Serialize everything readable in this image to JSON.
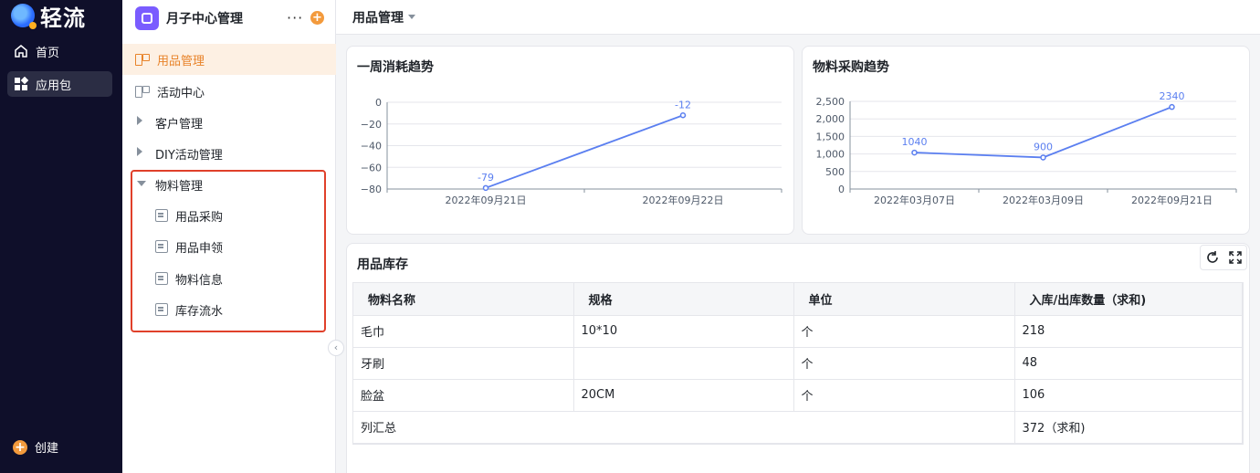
{
  "brand": {
    "name": "轻流"
  },
  "rail": {
    "items": [
      {
        "label": "首页"
      },
      {
        "label": "应用包"
      }
    ],
    "create_label": "创建"
  },
  "app": {
    "title": "月子中心管理",
    "more": "···",
    "add": "+",
    "menu": [
      {
        "label": "用品管理"
      },
      {
        "label": "活动中心"
      },
      {
        "label": "客户管理"
      },
      {
        "label": "DIY活动管理"
      },
      {
        "label": "物料管理"
      }
    ],
    "submenu": [
      {
        "label": "用品采购"
      },
      {
        "label": "用品申领"
      },
      {
        "label": "物料信息"
      },
      {
        "label": "库存流水"
      }
    ]
  },
  "page": {
    "title": "用品管理"
  },
  "charts": [
    {
      "type": "line",
      "title": "一周消耗趋势",
      "x": [
        "2022年09月21日",
        "2022年09月22日"
      ],
      "values": [
        -79,
        -12
      ],
      "point_labels": [
        "-79",
        "-12"
      ],
      "ylim": [
        -80,
        0
      ],
      "yticks": [
        "0",
        "−20",
        "−40",
        "−60",
        "−80"
      ],
      "ytick_values": [
        0,
        -20,
        -40,
        -60,
        -80
      ],
      "grid": true,
      "color": "#5b7ff0"
    },
    {
      "type": "line",
      "title": "物料采购趋势",
      "x": [
        "2022年03月07日",
        "2022年03月09日",
        "2022年09月21日"
      ],
      "values": [
        1040,
        900,
        2340
      ],
      "point_labels": [
        "1040",
        "900",
        "2340"
      ],
      "ylim": [
        0,
        2500
      ],
      "yticks": [
        "2,500",
        "2,000",
        "1,500",
        "1,000",
        "500",
        "0"
      ],
      "ytick_values": [
        2500,
        2000,
        1500,
        1000,
        500,
        0
      ],
      "grid": true,
      "color": "#5b7ff0"
    }
  ],
  "inventory": {
    "title": "用品库存",
    "columns": [
      "物料名称",
      "规格",
      "单位",
      "入库/出库数量（求和)"
    ],
    "rows": [
      [
        "毛巾",
        "10*10",
        "个",
        "218"
      ],
      [
        "牙刷",
        "",
        "个",
        "48"
      ],
      [
        "脸盆",
        "20CM",
        "个",
        "106"
      ]
    ],
    "total_label": "列汇总",
    "total_value": "372（求和)"
  },
  "colors": {
    "accent": "#e8832a",
    "highlight": "#e0402a",
    "line": "#5b7ff0"
  }
}
